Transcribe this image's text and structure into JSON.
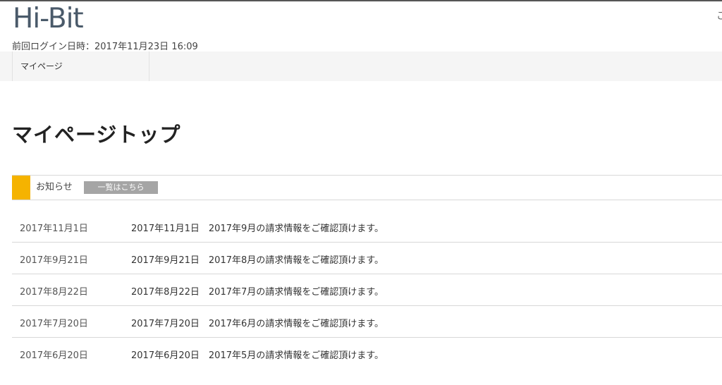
{
  "header": {
    "logo_text": "Hi-Bit",
    "top_right_text": "こ",
    "last_login": "前回ログイン日時：2017年11月23日 16:09"
  },
  "nav": {
    "items": [
      {
        "label": "マイページ"
      }
    ]
  },
  "main": {
    "title": "マイページトップ",
    "news": {
      "label": "お知らせ",
      "more_label": "一覧はこちら",
      "items": [
        {
          "date": "2017年11月1日",
          "text": "2017年11月1日　2017年9月の請求情報をご確認頂けます。"
        },
        {
          "date": "2017年9月21日",
          "text": "2017年9月21日　2017年8月の請求情報をご確認頂けます。"
        },
        {
          "date": "2017年8月22日",
          "text": "2017年8月22日　2017年7月の請求情報をご確認頂けます。"
        },
        {
          "date": "2017年7月20日",
          "text": "2017年7月20日　2017年6月の請求情報をご確認頂けます。"
        },
        {
          "date": "2017年6月20日",
          "text": "2017年6月20日　2017年5月の請求情報をご確認頂けます。"
        }
      ]
    }
  },
  "colors": {
    "accent": "#f5b300",
    "logo": "#4a5a6a",
    "nav_background": "#f5f5f5",
    "more_button": "#a5a5a5"
  }
}
